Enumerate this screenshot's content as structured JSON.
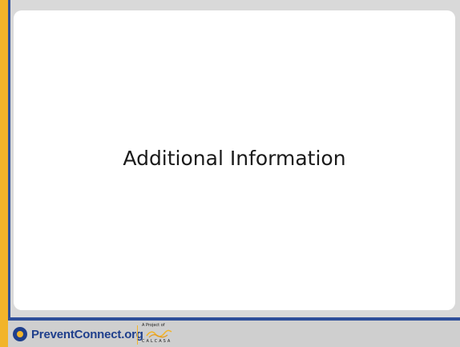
{
  "slide": {
    "title": "Additional Information"
  },
  "footer": {
    "logo_text": "PreventConnect.org",
    "project_label": "A Project of",
    "partner_name": "CALCASA"
  },
  "colors": {
    "accent_yellow": "#f2b42a",
    "accent_blue": "#2f4f9a",
    "footer_gray": "#cfcfcf"
  }
}
